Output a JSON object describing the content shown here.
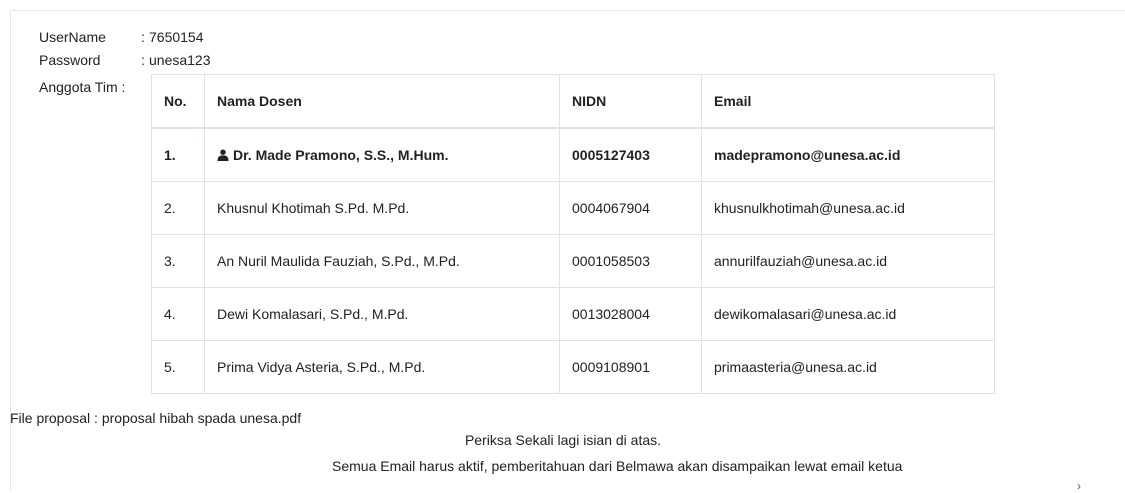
{
  "credentials": {
    "username_label": "UserName",
    "username_value": "7650154",
    "password_label": "Password",
    "password_value": "unesa123",
    "separator": ":"
  },
  "team": {
    "label": "Anggota Tim :",
    "columns": [
      "No.",
      "Nama Dosen",
      "NIDN",
      "Email"
    ],
    "rows": [
      {
        "no": "1.",
        "name": "Dr. Made Pramono, S.S., M.Hum.",
        "nidn": "0005127403",
        "email": "madepramono@unesa.ac.id",
        "is_ketua": true,
        "icon": "user-icon"
      },
      {
        "no": "2.",
        "name": "Khusnul Khotimah S.Pd. M.Pd.",
        "nidn": "0004067904",
        "email": "khusnulkhotimah@unesa.ac.id"
      },
      {
        "no": "3.",
        "name": "An Nuril Maulida Fauziah, S.Pd., M.Pd.",
        "nidn": "0001058503",
        "email": "annurilfauziah@unesa.ac.id"
      },
      {
        "no": "4.",
        "name": "Dewi Komalasari, S.Pd., M.Pd.",
        "nidn": "0013028004",
        "email": "dewikomalasari@unesa.ac.id"
      },
      {
        "no": "5.",
        "name": "Prima Vidya Asteria, S.Pd., M.Pd.",
        "nidn": "0009108901",
        "email": "primaasteria@unesa.ac.id"
      }
    ]
  },
  "file": {
    "label": "File proposal :",
    "value": "proposal hibah spada unesa.pdf"
  },
  "notices": {
    "line1": "Periksa Sekali lagi isian di atas.",
    "line2": "Semua Email harus aktif, pemberitahuan dari Belmawa akan disampaikan lewat email ketua"
  },
  "colors": {
    "text": "#222222",
    "border": "#dee2e6",
    "background": "#ffffff"
  }
}
